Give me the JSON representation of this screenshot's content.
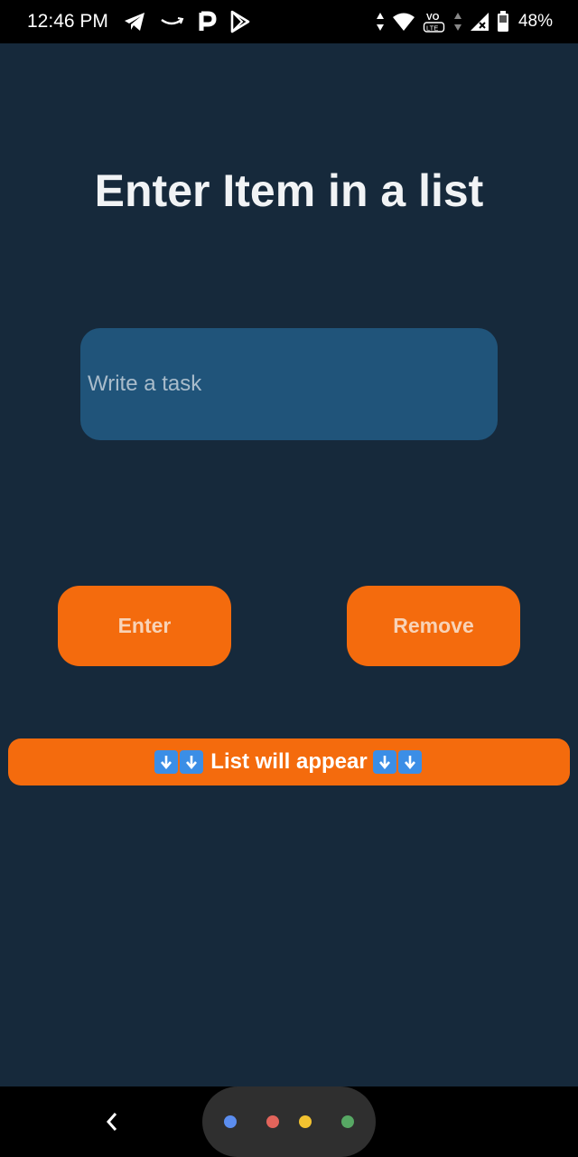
{
  "status_bar": {
    "time": "12:46 PM",
    "battery": "48%",
    "icons_left": [
      "telegram-icon",
      "amazon-icon",
      "paytm-icon",
      "play-store-icon"
    ],
    "icons_right": [
      "data-arrows-icon",
      "wifi-icon",
      "volte-icon",
      "signal-icon",
      "battery-icon"
    ]
  },
  "main": {
    "title": "Enter Item in a list",
    "input": {
      "placeholder": "Write a task",
      "value": ""
    },
    "enter_label": "Enter",
    "remove_label": "Remove",
    "banner_text": "List will appear",
    "banner_icon": "down-arrow-emoji"
  },
  "nav_bar": {
    "back_icon": "back-chevron-icon",
    "assistant_dots": [
      "#5b8def",
      "#e2645b",
      "#f2c230",
      "#57a864"
    ]
  },
  "colors": {
    "background": "#16293b",
    "input": "#20547a",
    "accent": "#f46b0d",
    "arrow_key": "#3b8ee6"
  }
}
